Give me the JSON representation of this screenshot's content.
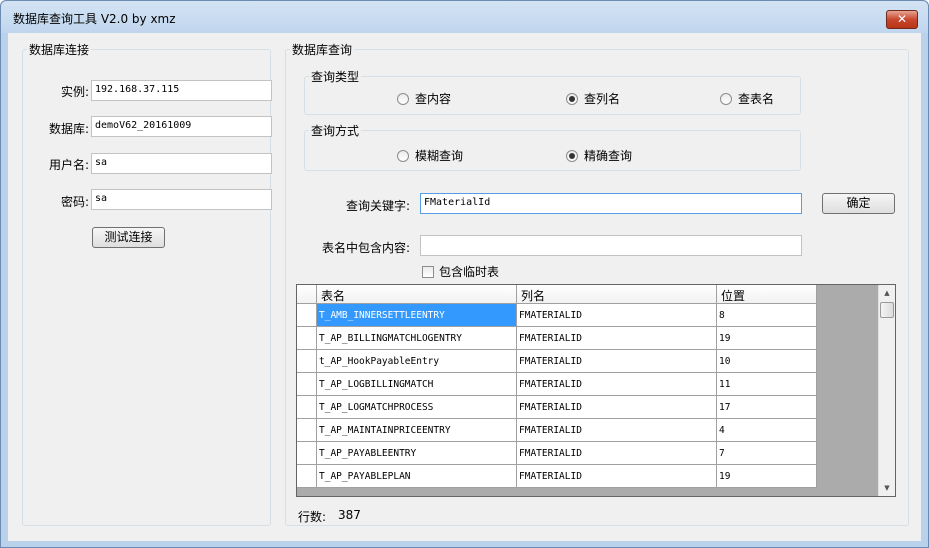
{
  "window": {
    "title": "数据库查询工具 V2.0 by xmz",
    "close_glyph": "✕"
  },
  "connection": {
    "group_label": "数据库连接",
    "instance_label": "实例:",
    "instance_value": "192.168.37.115",
    "database_label": "数据库:",
    "database_value": "demoV62_20161009",
    "username_label": "用户名:",
    "username_value": "sa",
    "password_label": "密码:",
    "password_value": "sa",
    "test_button": "测试连接"
  },
  "query": {
    "group_label": "数据库查询",
    "type_group_label": "查询类型",
    "type_options": [
      "查内容",
      "查列名",
      "查表名"
    ],
    "type_selected": "查列名",
    "method_group_label": "查询方式",
    "method_options": [
      "模糊查询",
      "精确查询"
    ],
    "method_selected": "精确查询",
    "keyword_label": "查询关键字:",
    "keyword_value": "FMaterialId",
    "confirm_button": "确定",
    "table_contains_label": "表名中包含内容:",
    "table_contains_value": "",
    "include_temp_label": "包含临时表",
    "include_temp_checked": false
  },
  "results": {
    "columns": [
      "表名",
      "列名",
      "位置"
    ],
    "rows": [
      [
        "T_AMB_INNERSETTLEENTRY",
        "FMATERIALID",
        "8"
      ],
      [
        "T_AP_BILLINGMATCHLOGENTRY",
        "FMATERIALID",
        "19"
      ],
      [
        "t_AP_HookPayableEntry",
        "FMATERIALID",
        "10"
      ],
      [
        "T_AP_LOGBILLINGMATCH",
        "FMATERIALID",
        "11"
      ],
      [
        "T_AP_LOGMATCHPROCESS",
        "FMATERIALID",
        "17"
      ],
      [
        "T_AP_MAINTAINPRICEENTRY",
        "FMATERIALID",
        "4"
      ],
      [
        "T_AP_PAYABLEENTRY",
        "FMATERIALID",
        "7"
      ],
      [
        "T_AP_PAYABLEPLAN",
        "FMATERIALID",
        "19"
      ]
    ],
    "row_count_label": "行数:",
    "row_count": "387"
  }
}
